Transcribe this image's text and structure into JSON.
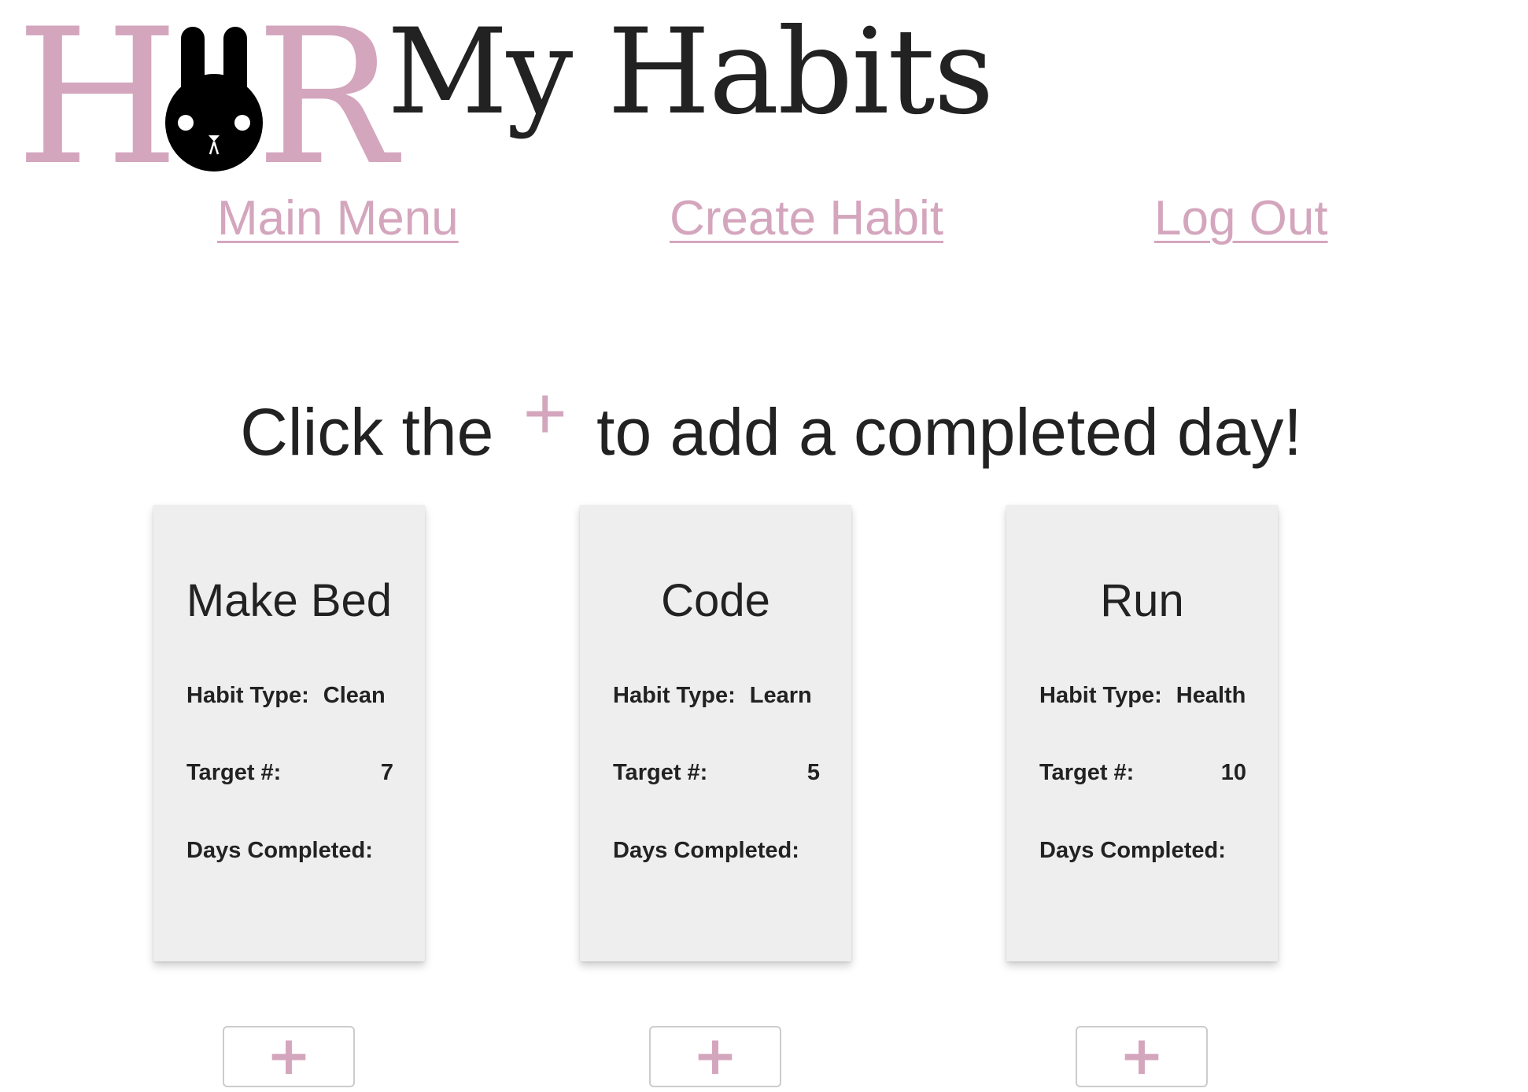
{
  "header": {
    "logo_letters": {
      "left": "H",
      "right": "R"
    },
    "title": "My Habits"
  },
  "colors": {
    "accent": "#d4a6bd",
    "text": "#222222",
    "card_bg": "#eeeeee"
  },
  "nav": {
    "main_menu": "Main Menu",
    "create_habit": "Create Habit",
    "log_out": "Log Out"
  },
  "instruction": {
    "before": "Click the",
    "plus": "+",
    "after": "to add a completed day!"
  },
  "habits": [
    {
      "name": "Make Bed",
      "type_label": "Habit Type:",
      "type": "Clean",
      "target_label": "Target #:",
      "target": "7",
      "days_label": "Days Completed:",
      "add_label": "+"
    },
    {
      "name": "Code",
      "type_label": "Habit Type:",
      "type": "Learn",
      "target_label": "Target #:",
      "target": "5",
      "days_label": "Days Completed:",
      "add_label": "+"
    },
    {
      "name": "Run",
      "type_label": "Habit Type:",
      "type": "Health",
      "target_label": "Target #:",
      "target": "10",
      "days_label": "Days Completed:",
      "add_label": "+"
    }
  ],
  "icons": {
    "logo_bunny": "bunny-icon",
    "add": "plus-icon"
  }
}
